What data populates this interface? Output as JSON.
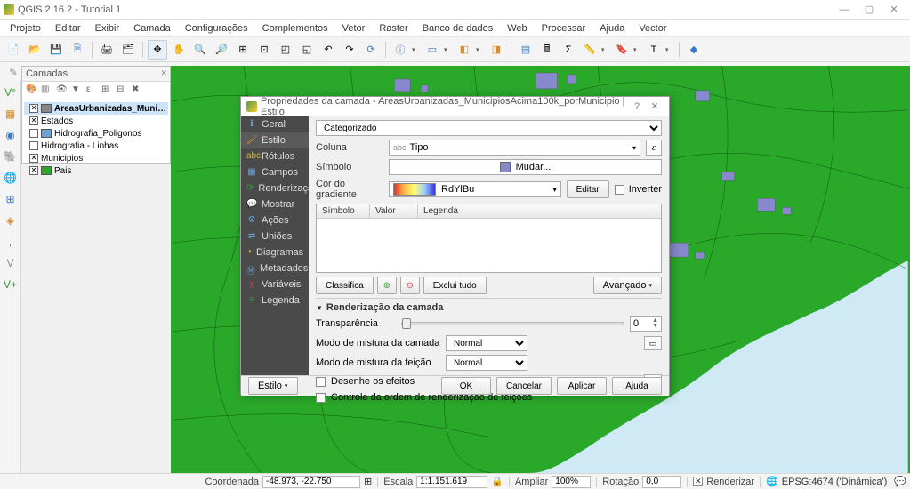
{
  "app": {
    "title": "QGIS 2.16.2 - Tutorial 1",
    "win_min": "—",
    "win_max": "▢",
    "win_close": "✕"
  },
  "menu": [
    "Projeto",
    "Editar",
    "Exibir",
    "Camada",
    "Configurações",
    "Complementos",
    "Vetor",
    "Raster",
    "Banco de dados",
    "Web",
    "Processar",
    "Ajuda",
    "Vector"
  ],
  "layers_panel": {
    "title": "Camadas",
    "items": [
      {
        "checked": true,
        "color": "#888",
        "name": "AreasUrbanizadas_MunicipiosA...",
        "sel": true
      },
      {
        "checked": true,
        "color": "none",
        "name": "Estados"
      },
      {
        "checked": false,
        "color": "#6aa0d6",
        "name": "Hidrografia_Poligonos"
      },
      {
        "checked": false,
        "color": "none",
        "name": "Hidrografia - Linhas"
      },
      {
        "checked": true,
        "color": "none",
        "name": "Municipios"
      },
      {
        "checked": true,
        "color": "#2aa82a",
        "name": "Pais"
      }
    ]
  },
  "dialog": {
    "title": "Propriedades da camada - AreasUrbanizadas_MunicipiosAcima100k_porMunicipio | Estilo",
    "help": "?",
    "close": "✕",
    "nav": [
      {
        "icon": "ℹ",
        "label": "Geral",
        "color": "#6aa0d6"
      },
      {
        "icon": "🖌",
        "label": "Estilo",
        "color": "#d88b2a",
        "sel": true
      },
      {
        "icon": "abc",
        "label": "Rótulos",
        "color": "#d6b82a"
      },
      {
        "icon": "▦",
        "label": "Campos",
        "color": "#6aa0d6"
      },
      {
        "icon": "⟳",
        "label": "Renderização",
        "color": "#3a9a3a"
      },
      {
        "icon": "💬",
        "label": "Mostrar",
        "color": "#d6b82a"
      },
      {
        "icon": "⚙",
        "label": "Ações",
        "color": "#6aa0d6"
      },
      {
        "icon": "⇄",
        "label": "Uniões",
        "color": "#6aa0d6"
      },
      {
        "icon": "◔",
        "label": "Diagramas",
        "color": "#d6b82a"
      },
      {
        "icon": "Ⓜ",
        "label": "Metadados",
        "color": "#6aa0d6"
      },
      {
        "icon": "χ",
        "label": "Variáveis",
        "color": "#c44"
      },
      {
        "icon": "≡",
        "label": "Legenda",
        "color": "#3a9a3a"
      }
    ],
    "style_type": "Categorizado",
    "col_label": "Coluna",
    "col_prefix": "abc",
    "col_value": "Tipo",
    "col_btn": "ε",
    "sym_label": "Símbolo",
    "sym_change": "Mudar...",
    "grad_label": "Cor do gradiente",
    "grad_name": "RdYlBu",
    "grad_edit": "Editar",
    "grad_invert": "Inverter",
    "tbl_h1": "Símbolo",
    "tbl_h2": "Valor",
    "tbl_h3": "Legenda",
    "btn_classify": "Classifica",
    "btn_add": "⊕",
    "btn_del": "⊖",
    "btn_clear": "Exclui tudo",
    "btn_adv": "Avançado",
    "render_hdr": "Renderização da camada",
    "transp_label": "Transparência",
    "transp_val": "0",
    "blend_layer_label": "Modo de mistura da camada",
    "blend_layer_val": "Normal",
    "blend_feat_label": "Modo de mistura da feição",
    "blend_feat_val": "Normal",
    "chk_effects": "Desenhe os efeitos",
    "chk_order": "Controle da ordem de renderização de feições",
    "footer_style": "Estilo",
    "footer_ok": "OK",
    "footer_cancel": "Cancelar",
    "footer_apply": "Aplicar",
    "footer_help": "Ajuda"
  },
  "status": {
    "coord_label": "Coordenada",
    "coord_val": "-48.973, -22.750",
    "scale_label": "Escala",
    "scale_val": "1:1.151.619",
    "zoom_label": "Ampliar",
    "zoom_val": "100%",
    "rot_label": "Rotação",
    "rot_val": "0,0",
    "render_label": "Renderizar",
    "crs": "EPSG:4674 ('Dinâmica')"
  }
}
